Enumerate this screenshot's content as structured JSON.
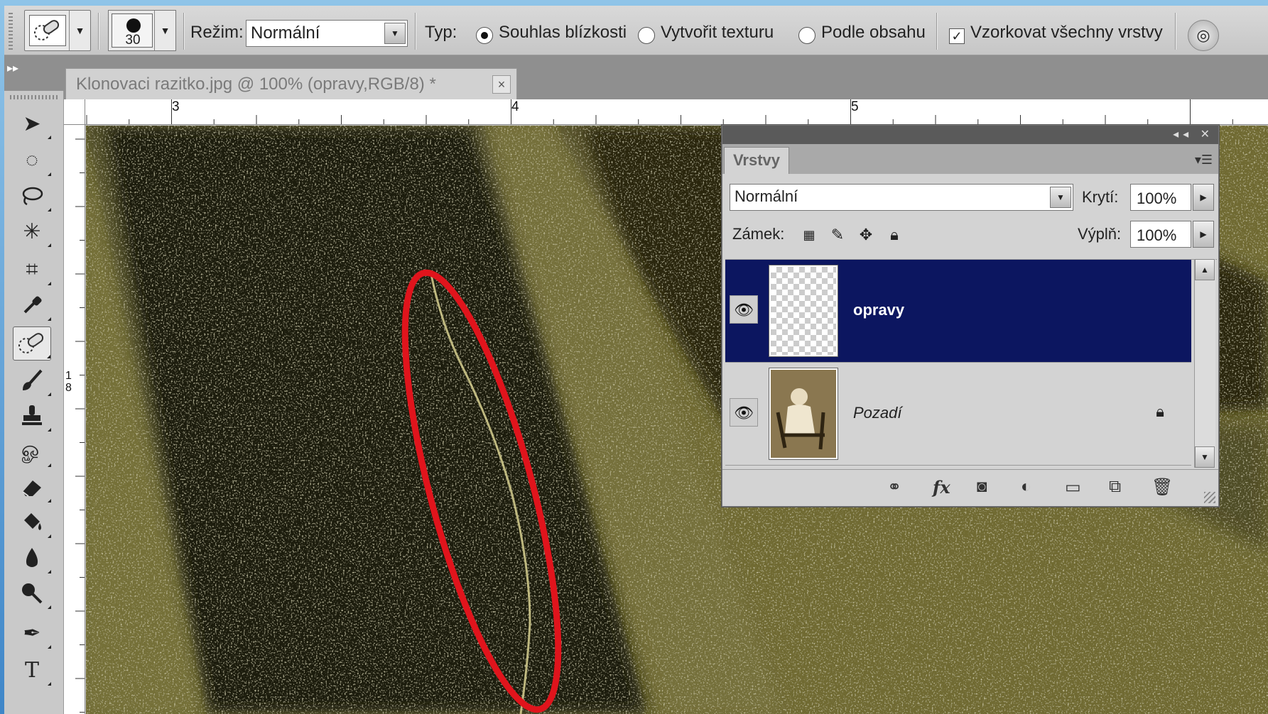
{
  "options_bar": {
    "brush_size": "30",
    "mode_label": "Režim:",
    "mode_value": "Normální",
    "type_label": "Typ:",
    "radio_options": [
      "Souhlas blízkosti",
      "Vytvořit texturu",
      "Podle obsahu"
    ],
    "selected_radio": "Souhlas blízkosti",
    "sample_all_label": "Vzorkovat všechny vrstvy",
    "sample_all_checked": true
  },
  "document_tab": {
    "title": "Klonovaci razitko.jpg @ 100% (opravy,RGB/8) *",
    "close": "×"
  },
  "rulers": {
    "horizontal_labels": [
      "3",
      "4",
      "5"
    ],
    "vertical_labels": [
      "1",
      "8"
    ]
  },
  "layers_panel": {
    "tab_label": "Vrstvy",
    "blend_mode": "Normální",
    "opacity_label": "Krytí:",
    "opacity_value": "100%",
    "lock_label": "Zámek:",
    "fill_label": "Výplň:",
    "fill_value": "100%",
    "layers": [
      {
        "name": "opravy",
        "visible": true,
        "selected": true,
        "locked": false
      },
      {
        "name": "Pozadí",
        "visible": true,
        "selected": false,
        "locked": true
      }
    ]
  },
  "colors": {
    "selection_highlight": "#0c1660",
    "annotation_ellipse": "#e0141c",
    "background_gradient_top": "#8fc4e8",
    "background_gradient_bottom": "#3f86c8"
  },
  "icons": {
    "options_bar": [
      "spot-healing-brush-icon",
      "airbrush-icon"
    ],
    "toolbox": [
      "move-icon",
      "elliptical-marquee-icon",
      "lasso-icon",
      "magic-wand-icon",
      "crop-icon",
      "eyedropper-icon",
      "spot-healing-brush-icon",
      "brush-icon",
      "clone-stamp-icon",
      "history-brush-icon",
      "eraser-icon",
      "paint-bucket-icon",
      "blur-icon",
      "dodge-icon",
      "pen-icon",
      "type-icon"
    ],
    "layers_footer": [
      "link-layers-icon",
      "fx-icon",
      "layer-mask-icon",
      "adjustment-layer-icon",
      "group-folder-icon",
      "new-layer-icon",
      "trash-icon"
    ]
  }
}
